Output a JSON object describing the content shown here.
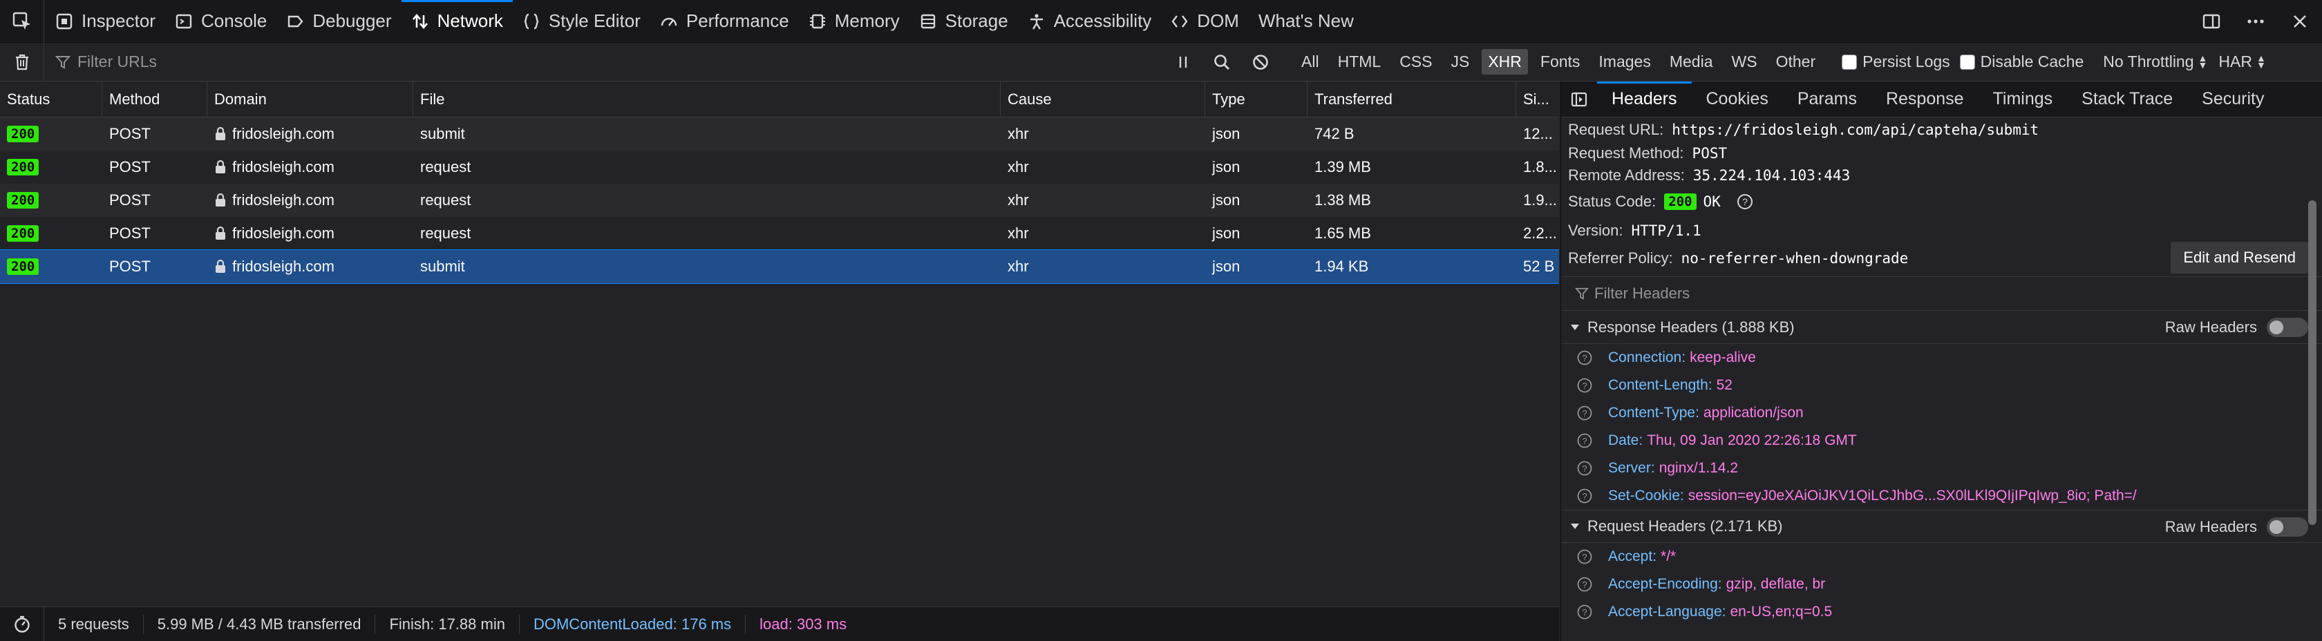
{
  "toolbox": {
    "tabs": [
      {
        "label": "Inspector",
        "icon": "inspector-icon"
      },
      {
        "label": "Console",
        "icon": "console-icon"
      },
      {
        "label": "Debugger",
        "icon": "debugger-icon"
      },
      {
        "label": "Network",
        "icon": "network-icon",
        "active": true
      },
      {
        "label": "Style Editor",
        "icon": "style-editor-icon"
      },
      {
        "label": "Performance",
        "icon": "performance-icon"
      },
      {
        "label": "Memory",
        "icon": "memory-icon"
      },
      {
        "label": "Storage",
        "icon": "storage-icon"
      },
      {
        "label": "Accessibility",
        "icon": "accessibility-icon"
      },
      {
        "label": "DOM",
        "icon": "dom-icon"
      },
      {
        "label": "What's New",
        "icon": "whats-new-icon"
      }
    ]
  },
  "filterbar": {
    "placeholder": "Filter URLs",
    "types": [
      "All",
      "HTML",
      "CSS",
      "JS",
      "XHR",
      "Fonts",
      "Images",
      "Media",
      "WS",
      "Other"
    ],
    "active_type": "XHR",
    "persist_logs": "Persist Logs",
    "disable_cache": "Disable Cache",
    "throttling": "No Throttling",
    "har": "HAR"
  },
  "table": {
    "columns": [
      "Status",
      "Method",
      "Domain",
      "File",
      "Cause",
      "Type",
      "Transferred",
      "Si..."
    ],
    "rows": [
      {
        "status": "200",
        "method": "POST",
        "domain": "fridosleigh.com",
        "file": "submit",
        "cause": "xhr",
        "type": "json",
        "transferred": "742 B",
        "size": "12..."
      },
      {
        "status": "200",
        "method": "POST",
        "domain": "fridosleigh.com",
        "file": "request",
        "cause": "xhr",
        "type": "json",
        "transferred": "1.39 MB",
        "size": "1.8..."
      },
      {
        "status": "200",
        "method": "POST",
        "domain": "fridosleigh.com",
        "file": "request",
        "cause": "xhr",
        "type": "json",
        "transferred": "1.38 MB",
        "size": "1.9..."
      },
      {
        "status": "200",
        "method": "POST",
        "domain": "fridosleigh.com",
        "file": "request",
        "cause": "xhr",
        "type": "json",
        "transferred": "1.65 MB",
        "size": "2.2..."
      },
      {
        "status": "200",
        "method": "POST",
        "domain": "fridosleigh.com",
        "file": "submit",
        "cause": "xhr",
        "type": "json",
        "transferred": "1.94 KB",
        "size": "52 B"
      }
    ]
  },
  "statusbar": {
    "requests": "5 requests",
    "size": "5.99 MB / 4.43 MB transferred",
    "finish": "Finish: 17.88 min",
    "dom": "DOMContentLoaded: 176 ms",
    "load": "load: 303 ms",
    "dom_color": "#75bfff",
    "load_color": "#ff7de9"
  },
  "side": {
    "tabs": [
      "Headers",
      "Cookies",
      "Params",
      "Response",
      "Timings",
      "Stack Trace",
      "Security"
    ],
    "active_tab": "Headers",
    "summary": {
      "url_k": "Request URL:",
      "url_v": "https://fridosleigh.com/api/capteha/submit",
      "method_k": "Request Method:",
      "method_v": "POST",
      "remote_k": "Remote Address:",
      "remote_v": "35.224.104.103:443",
      "status_k": "Status Code:",
      "status_code": "200",
      "status_text": "OK",
      "version_k": "Version:",
      "version_v": "HTTP/1.1",
      "referrer_k": "Referrer Policy:",
      "referrer_v": "no-referrer-when-downgrade"
    },
    "edit_resend": "Edit and Resend",
    "filter_headers": "Filter Headers",
    "response_headers_title": "Response Headers (1.888 KB)",
    "request_headers_title": "Request Headers (2.171 KB)",
    "raw_headers": "Raw Headers",
    "response_headers": [
      {
        "k": "Connection:",
        "v": "keep-alive"
      },
      {
        "k": "Content-Length:",
        "v": "52"
      },
      {
        "k": "Content-Type:",
        "v": "application/json"
      },
      {
        "k": "Date:",
        "v": "Thu, 09 Jan 2020 22:26:18 GMT"
      },
      {
        "k": "Server:",
        "v": "nginx/1.14.2"
      },
      {
        "k": "Set-Cookie:",
        "v": "session=eyJ0eXAiOiJKV1QiLCJhbG...SX0lLKl9QIjIPqIwp_8io; Path=/"
      }
    ],
    "request_headers": [
      {
        "k": "Accept:",
        "v": "*/*"
      },
      {
        "k": "Accept-Encoding:",
        "v": "gzip, deflate, br"
      },
      {
        "k": "Accept-Language:",
        "v": "en-US,en;q=0.5"
      }
    ]
  }
}
